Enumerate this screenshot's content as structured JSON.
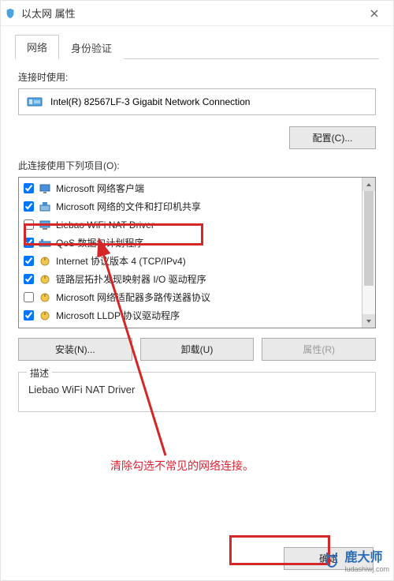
{
  "window": {
    "title": "以太网 属性"
  },
  "tabs": {
    "network": "网络",
    "auth": "身份验证"
  },
  "labels": {
    "connect_using": "连接时使用:",
    "this_connection_uses": "此连接使用下列项目(O):"
  },
  "adapter": {
    "name": "Intel(R) 82567LF-3 Gigabit Network Connection"
  },
  "buttons": {
    "configure": "配置(C)...",
    "install": "安装(N)...",
    "uninstall": "卸载(U)",
    "properties": "属性(R)",
    "ok": "确定"
  },
  "items": [
    {
      "checked": true,
      "icon": "client",
      "label": "Microsoft 网络客户端"
    },
    {
      "checked": true,
      "icon": "share",
      "label": "Microsoft 网络的文件和打印机共享"
    },
    {
      "checked": false,
      "icon": "driver",
      "label": "Liebao WiFi NAT Driver"
    },
    {
      "checked": true,
      "icon": "qos",
      "label": "QoS 数据包计划程序"
    },
    {
      "checked": true,
      "icon": "proto",
      "label": "Internet 协议版本 4 (TCP/IPv4)"
    },
    {
      "checked": true,
      "icon": "proto",
      "label": "链路层拓扑发现映射器 I/O 驱动程序"
    },
    {
      "checked": false,
      "icon": "proto",
      "label": "Microsoft 网络适配器多路传送器协议"
    },
    {
      "checked": true,
      "icon": "proto",
      "label": "Microsoft LLDP 协议驱动程序"
    }
  ],
  "group": {
    "legend": "描述",
    "desc": "Liebao WiFi NAT Driver"
  },
  "annotation": "清除勾选不常见的网络连接。",
  "watermark": {
    "brand": "鹿大师",
    "url": "ludashiwj.com"
  }
}
